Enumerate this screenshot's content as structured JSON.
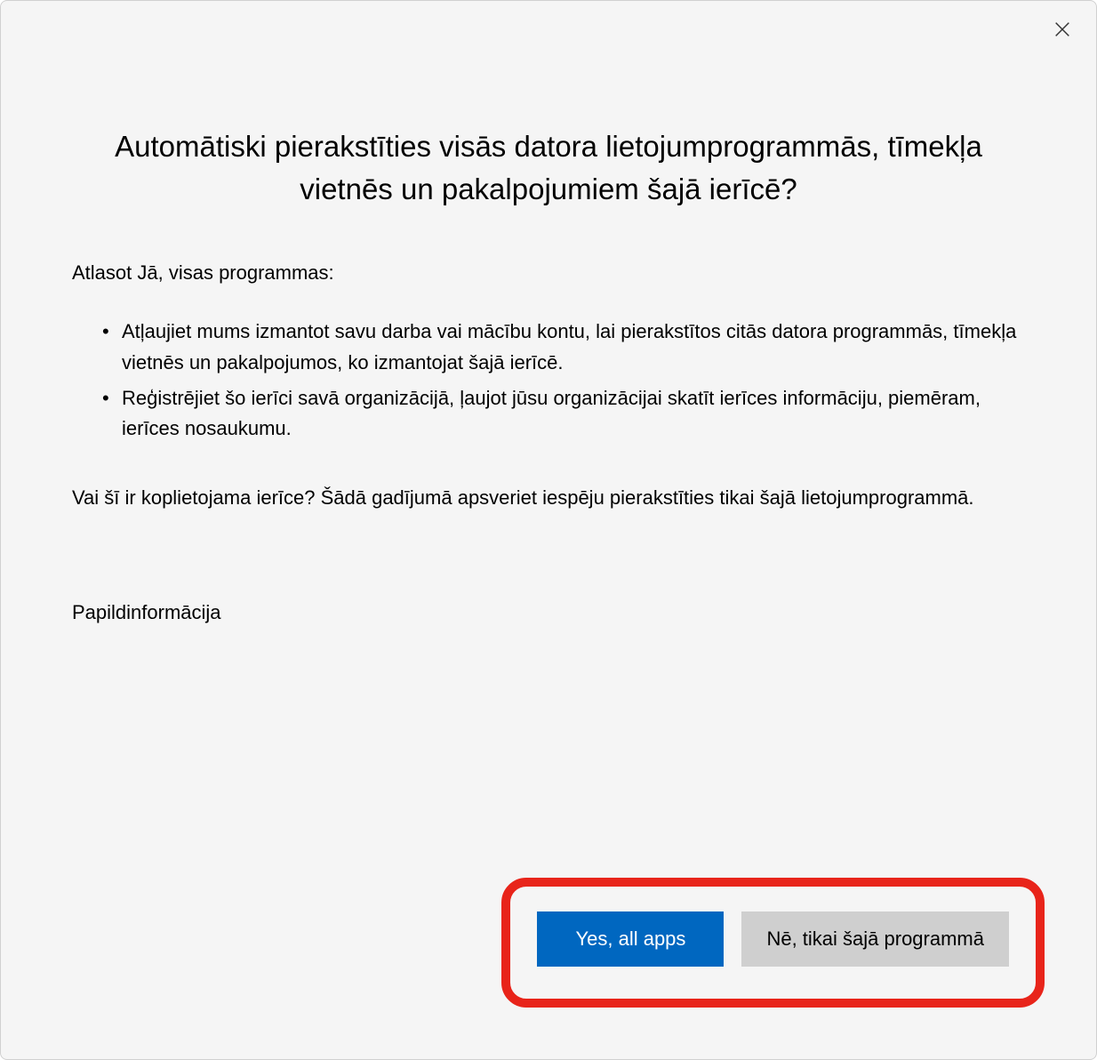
{
  "dialog": {
    "heading": "Automātiski pierakstīties visās datora lietojumprogrammās, tīmekļa vietnēs un pakalpojumiem šajā ierīcē?",
    "intro_text": "Atlasot Jā, visas programmas:",
    "bullets": [
      "Atļaujiet mums izmantot savu darba vai mācību kontu, lai pierakstītos citās datora programmās, tīmekļa vietnēs un pakalpojumos, ko izmantojat šajā ierīcē.",
      "Reģistrējiet šo ierīci savā organizācijā, ļaujot jūsu organizācijai skatīt ierīces informāciju, piemēram, ierīces nosaukumu."
    ],
    "shared_device_text": "Vai šī ir koplietojama ierīce? Šādā gadījumā apsveriet iespēju pierakstīties tikai šajā lietojumprogrammā.",
    "more_info_label": "Papildinformācija",
    "buttons": {
      "yes_label": "Yes, all apps",
      "no_label": "Nē, tikai šajā programmā"
    }
  },
  "colors": {
    "primary_button_bg": "#0067c0",
    "secondary_button_bg": "#cfcfcf",
    "highlight_border": "#e8241a"
  }
}
